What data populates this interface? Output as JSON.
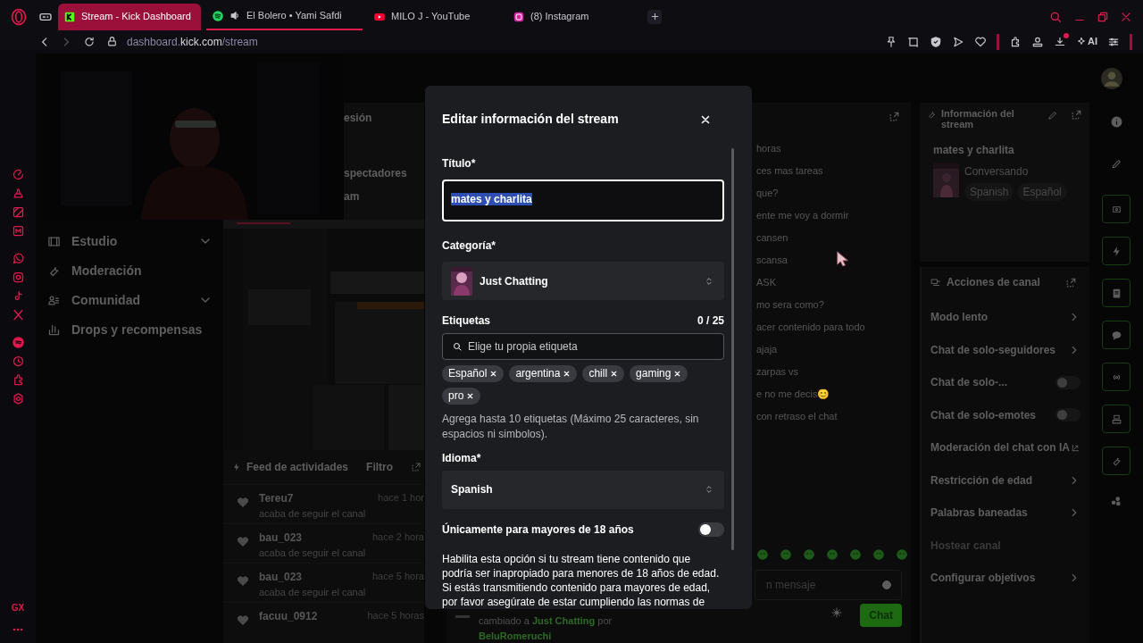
{
  "browser": {
    "tabs": [
      {
        "label": "Stream - Kick Dashboard",
        "selected": true,
        "audio_playing": false
      },
      {
        "label": "El Bolero • Yami Safdi",
        "selected": false,
        "audio_playing": true
      },
      {
        "label": "MILO J - YouTube",
        "selected": false,
        "audio_playing": false
      },
      {
        "label": "(8) Instagram",
        "selected": false,
        "audio_playing": false
      }
    ],
    "address": {
      "subdomain": "dashboard.",
      "domain": "kick.com",
      "path": "/stream"
    },
    "ai_label": "AI",
    "download_badge": true,
    "sidebar_label": "GX"
  },
  "dashboard": {
    "session_fragments": [
      "esión",
      "spectadores",
      "am"
    ],
    "menu": [
      {
        "label": "Estudio",
        "has_submenu": true
      },
      {
        "label": "Moderación",
        "has_submenu": false
      },
      {
        "label": "Comunidad",
        "has_submenu": true
      },
      {
        "label": "Drops y recompensas",
        "has_submenu": false
      }
    ],
    "feed": {
      "title": "Feed de actividades",
      "filter": "Filtro",
      "items": [
        {
          "name": "Tereu7",
          "time": "hace 1 hor",
          "action": "acaba de seguir el canal"
        },
        {
          "name": "bau_023",
          "time": "hace 2 hora",
          "action": "acaba de seguir el canal"
        },
        {
          "name": "bau_023",
          "time": "hace 5 hora",
          "action": "acaba de seguir el canal"
        },
        {
          "name": "facuu_0912",
          "time": "hace 5 horas"
        }
      ]
    },
    "chat": {
      "messages": [
        "horas",
        "ces mas tareas",
        "que?",
        "ente me voy a dormir",
        "cansen",
        "scansa",
        "ASK",
        "mo sera como?",
        "acer contenido para todo",
        "ajaja",
        "zarpas vs",
        "e no me decis😊",
        "con retraso el chat"
      ],
      "input_placeholder": "n mensaje",
      "send_label": "Chat",
      "system_message": [
        {
          "text": "cambiado a ",
          "highlight": false
        },
        {
          "text": "Just Chatting",
          "highlight": true
        },
        {
          "text": " por",
          "highlight": false
        }
      ],
      "system_user": "BeluRomeruchi"
    },
    "stream_info": {
      "title": "Información del stream",
      "stream_title": "mates y charlita",
      "category": "Conversando",
      "tags": [
        "Spanish",
        "Español"
      ]
    },
    "channel_actions": {
      "title": "Acciones de canal",
      "items": [
        {
          "label": "Modo lento",
          "kind": "link",
          "disabled": false
        },
        {
          "label": "Chat de solo-seguidores",
          "kind": "link",
          "disabled": false
        },
        {
          "label": "Chat de solo-...",
          "kind": "toggle",
          "on": false,
          "disabled": false
        },
        {
          "label": "Chat de solo-emotes",
          "kind": "toggle",
          "on": false,
          "disabled": false
        },
        {
          "label": "Moderación del chat con IA",
          "kind": "external",
          "disabled": false
        },
        {
          "label": "Restricción de edad",
          "kind": "link",
          "disabled": false
        },
        {
          "label": "Palabras baneadas",
          "kind": "link",
          "disabled": false
        },
        {
          "label": "Hostear canal",
          "kind": "plain",
          "disabled": true
        },
        {
          "label": "Configurar objetivos",
          "kind": "link",
          "disabled": false
        }
      ]
    }
  },
  "modal": {
    "title": "Editar información del stream",
    "title_label": "Título*",
    "title_value": "mates y charlita",
    "title_value_selected": true,
    "category_label": "Categoría*",
    "category_value": "Just Chatting",
    "tags_label": "Etiquetas",
    "tags_count": "0 / 25",
    "tags_placeholder": "Elige tu propia etiqueta",
    "tags": [
      "Español",
      "argentina",
      "chill",
      "gaming",
      "pro"
    ],
    "tags_hint": "Agrega hasta 10 etiquetas (Máximo 25 caracteres, sin espacios ni simbolos).",
    "language_label": "Idioma*",
    "language_value": "Spanish",
    "adult_label": "Únicamente para mayores de 18 años",
    "adult_on": false,
    "adult_description": "Habilita esta opción si tu stream tiene contenido que podría ser inapropiado para menores de 18 años de edad. Si estás transmitiendo contenido para mayores de edad, por favor asegúrate de estar cumpliendo las normas de"
  }
}
